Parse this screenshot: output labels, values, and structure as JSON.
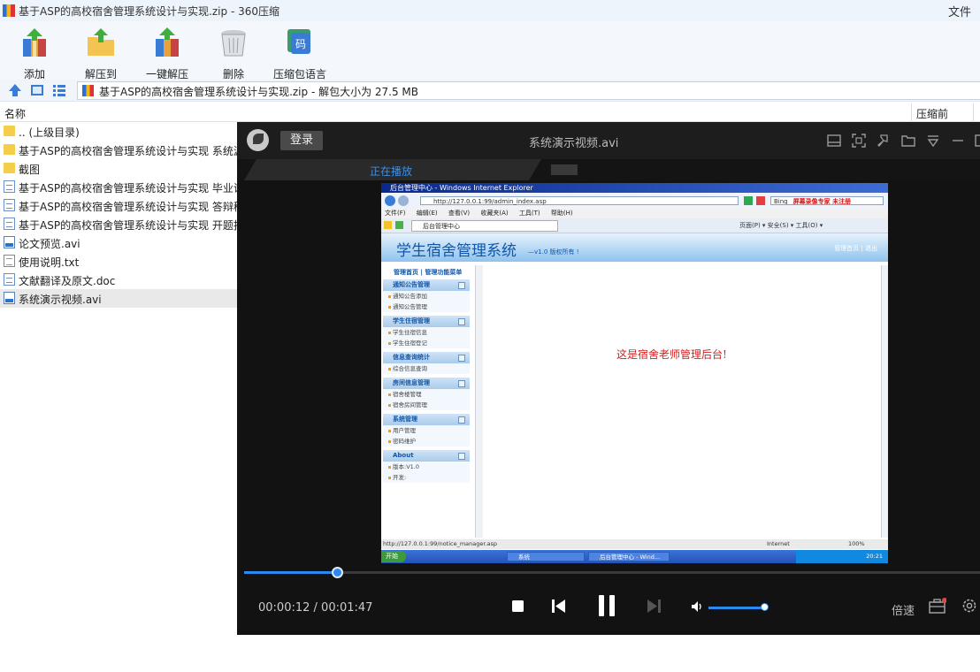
{
  "window": {
    "title": "基于ASP的高校宿舍管理系统设计与实现.zip - 360压缩",
    "menu_file": "文件"
  },
  "toolbar": {
    "buttons": [
      {
        "label": "添加",
        "icon": "add-archive-icon"
      },
      {
        "label": "解压到",
        "icon": "extract-to-icon"
      },
      {
        "label": "一键解压",
        "icon": "one-click-extract-icon"
      },
      {
        "label": "删除",
        "icon": "delete-icon"
      },
      {
        "label": "压缩包语言",
        "icon": "archive-language-icon"
      }
    ]
  },
  "address": {
    "path": "基于ASP的高校宿舍管理系统设计与实现.zip - 解包大小为 27.5 MB"
  },
  "columns": {
    "name": "名称",
    "compressed": "压缩前"
  },
  "files": [
    {
      "name": ".. (上级目录)",
      "type": "folder"
    },
    {
      "name": "基于ASP的高校宿舍管理系统设计与实现 系统源",
      "type": "folder"
    },
    {
      "name": "截图",
      "type": "folder"
    },
    {
      "name": "基于ASP的高校宿舍管理系统设计与实现 毕业论",
      "type": "doc"
    },
    {
      "name": "基于ASP的高校宿舍管理系统设计与实现 答辩稿",
      "type": "doc"
    },
    {
      "name": "基于ASP的高校宿舍管理系统设计与实现 开题报",
      "type": "doc"
    },
    {
      "name": "论文预览.avi",
      "type": "avi"
    },
    {
      "name": "使用说明.txt",
      "type": "txt"
    },
    {
      "name": "文献翻译及原文.doc",
      "type": "doc"
    },
    {
      "name": "系统演示视频.avi",
      "type": "avi",
      "selected": true
    }
  ],
  "player": {
    "login": "登录",
    "title": "系统演示视频.avi",
    "tab": "正在播放",
    "current_time": "00:00:12",
    "total_time": "00:01:47",
    "progress": 0.126,
    "volume": 0.8,
    "speed_label": "倍速",
    "accent": "#2b8af0"
  },
  "screen": {
    "ie_title": "后台管理中心 - Windows Internet Explorer",
    "url": "http://127.0.0.1:99/admin_index.asp",
    "search_engine": "Bing",
    "watermark": "屏幕录像专家 未注册",
    "menus": [
      "文件(F)",
      "编辑(E)",
      "查看(V)",
      "收藏夹(A)",
      "工具(T)",
      "帮助(H)"
    ],
    "tab": "后台管理中心",
    "toolbar_right": "页面(P) ▾  安全(S) ▾  工具(O) ▾",
    "system_title": "学生宿舍管理系统",
    "version": "—v1.0 版权所有 !",
    "top_links": "管理首页 | 退出",
    "side_head": "管理首页 | 管理功能菜单",
    "groups": [
      {
        "title": "通知公告管理",
        "items": [
          "通知公告添加",
          "通知公告管理"
        ]
      },
      {
        "title": "学生住宿管理",
        "items": [
          "学生住宿信息",
          "学生住宿登记"
        ]
      },
      {
        "title": "信息查询统计",
        "items": [
          "综合信息查询"
        ]
      },
      {
        "title": "房间信息管理",
        "items": [
          "宿舍楼管理",
          "宿舍房间管理"
        ]
      },
      {
        "title": "系统管理",
        "items": [
          "用户管理",
          "密码维护"
        ]
      },
      {
        "title": "About",
        "items": [
          "版本:V1.0",
          "开发:"
        ]
      }
    ],
    "message": "这是宿舍老师管理后台!",
    "status_url": "http://127.0.0.1:99/notice_manager.asp",
    "zone": "Internet",
    "zoom": "100%",
    "taskbar_start": "开始",
    "taskbar_items": [
      "系统",
      "后台管理中心 - Wind..."
    ],
    "clock": "20:21"
  }
}
